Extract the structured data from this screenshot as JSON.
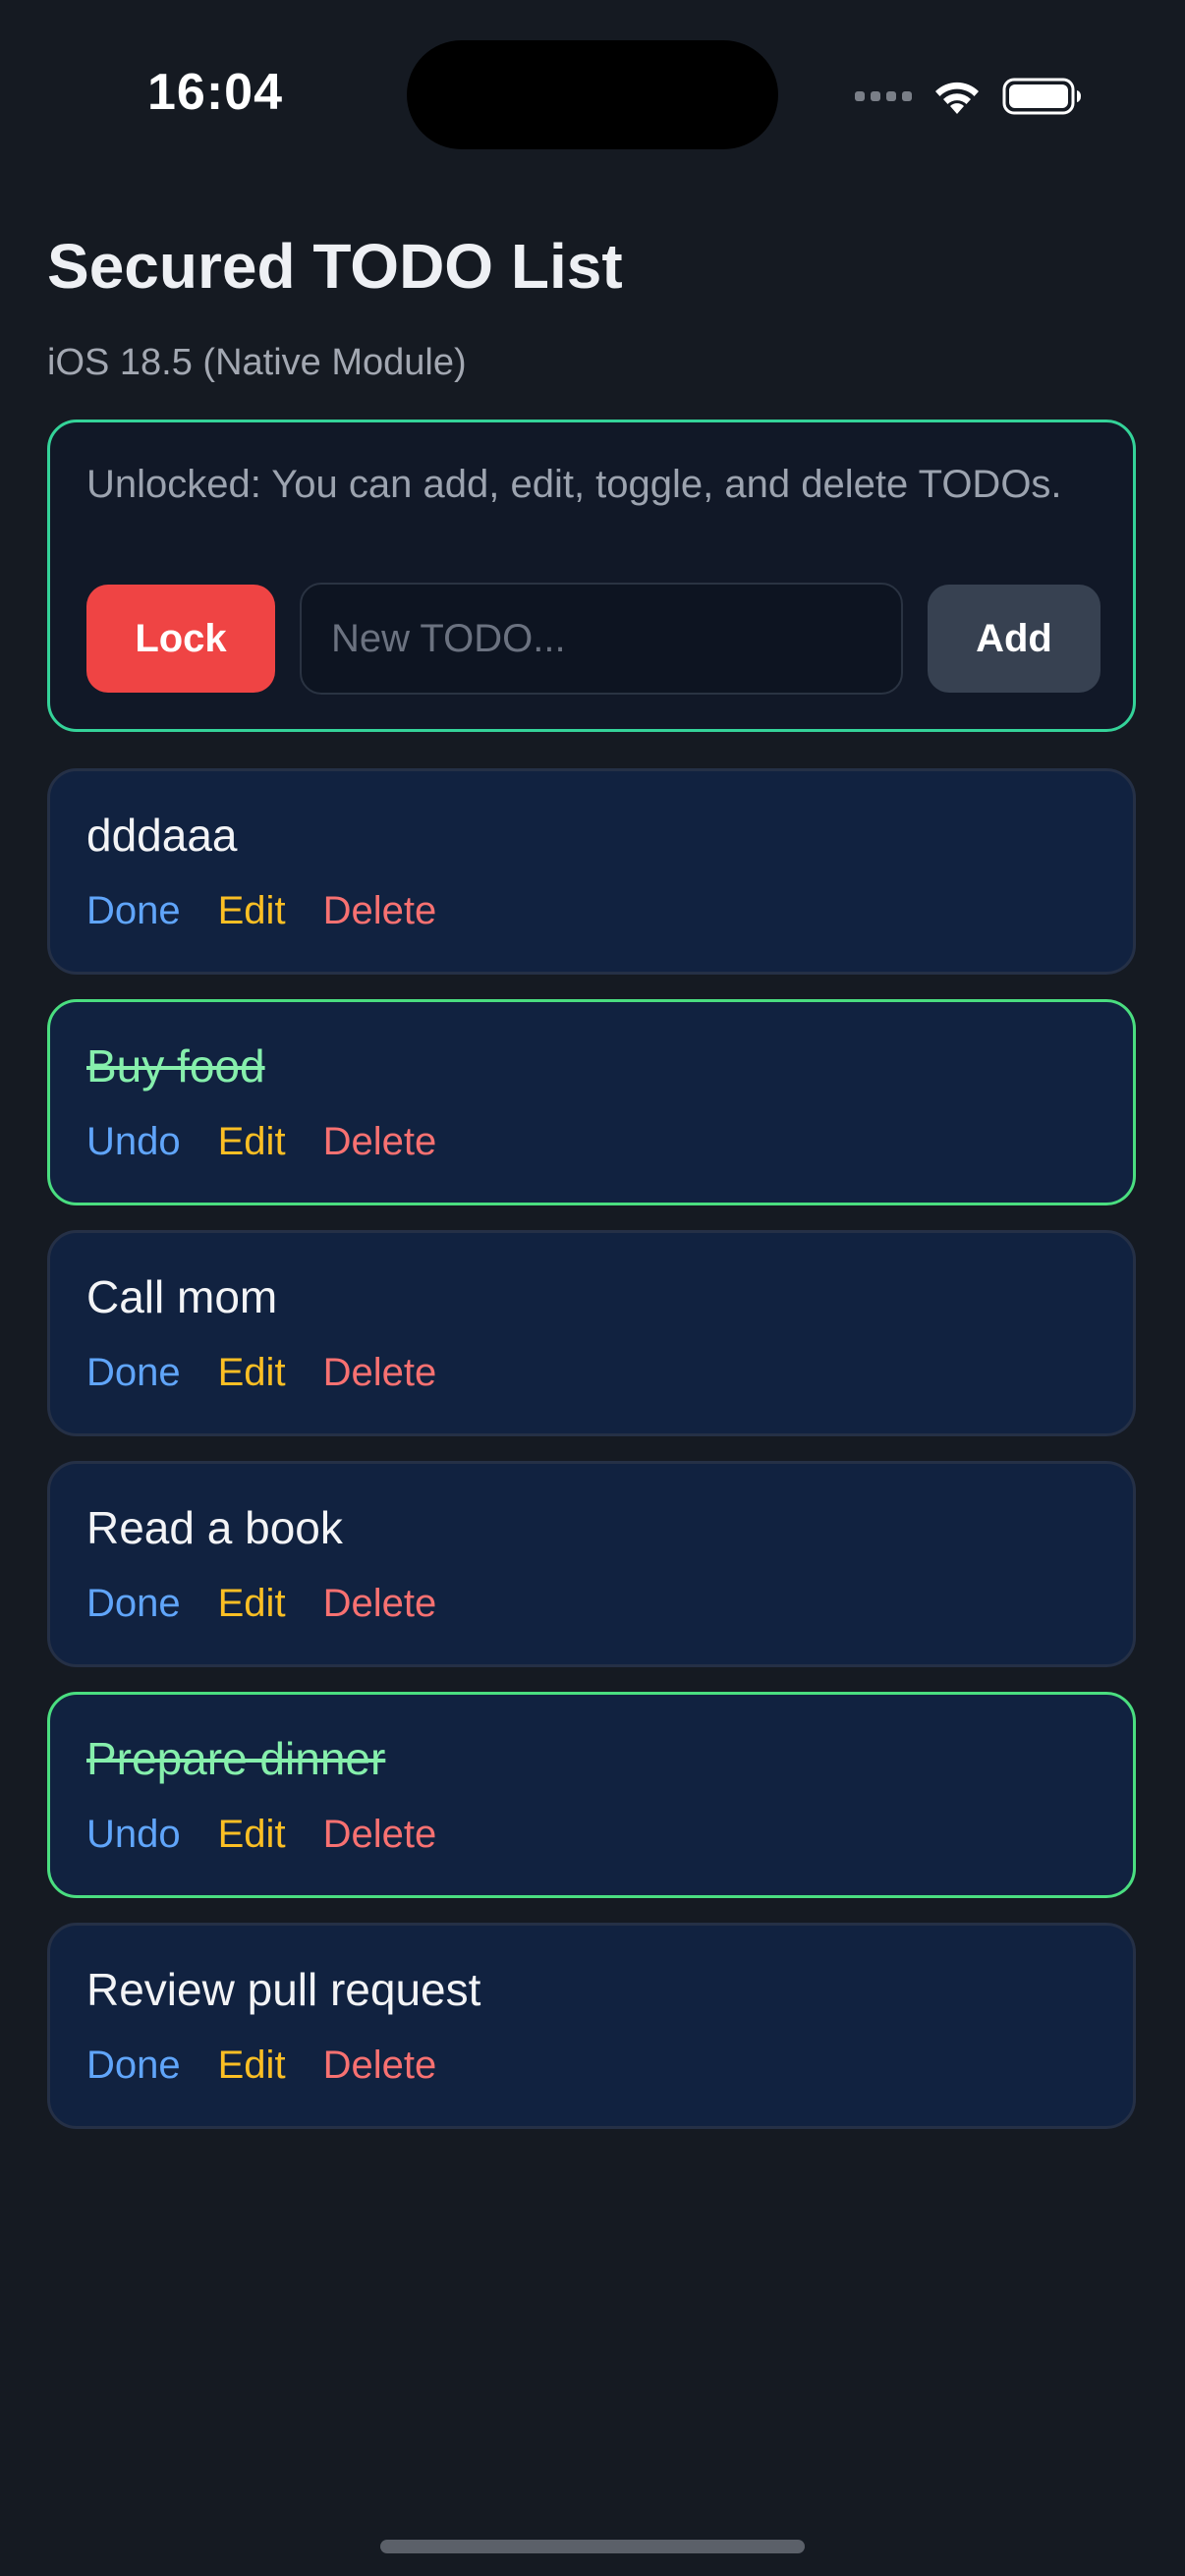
{
  "status_bar": {
    "time": "16:04"
  },
  "header": {
    "title": "Secured TODO List",
    "subtitle": "iOS 18.5 (Native Module)"
  },
  "unlock_panel": {
    "message": "Unlocked: You can add, edit, toggle, and delete TODOs.",
    "lock_label": "Lock",
    "input_placeholder": "New TODO...",
    "input_value": "",
    "add_label": "Add"
  },
  "todos": [
    {
      "text": "dddaaa",
      "done": false,
      "toggle_label": "Done",
      "edit_label": "Edit",
      "delete_label": "Delete"
    },
    {
      "text": "Buy food",
      "done": true,
      "toggle_label": "Undo",
      "edit_label": "Edit",
      "delete_label": "Delete"
    },
    {
      "text": "Call mom",
      "done": false,
      "toggle_label": "Done",
      "edit_label": "Edit",
      "delete_label": "Delete"
    },
    {
      "text": "Read a book",
      "done": false,
      "toggle_label": "Done",
      "edit_label": "Edit",
      "delete_label": "Delete"
    },
    {
      "text": "Prepare dinner",
      "done": true,
      "toggle_label": "Undo",
      "edit_label": "Edit",
      "delete_label": "Delete"
    },
    {
      "text": "Review pull request",
      "done": false,
      "toggle_label": "Done",
      "edit_label": "Edit",
      "delete_label": "Delete"
    }
  ],
  "colors": {
    "background": "#151a22",
    "accent_done": "#4ade80",
    "lock_button": "#ef4444",
    "toggle_link": "#60a5fa",
    "edit_link": "#fbbf24",
    "delete_link": "#f87171"
  },
  "icons": [
    "signal-icon",
    "wifi-icon",
    "battery-icon"
  ]
}
